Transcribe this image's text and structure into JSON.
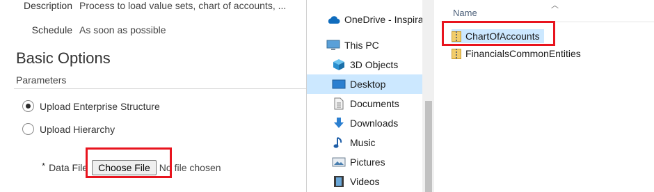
{
  "form": {
    "description_label": "Description",
    "description_value": "Process to load value sets, chart of accounts, ...",
    "schedule_label": "Schedule",
    "schedule_value": "As soon as possible",
    "section_title": "Basic Options",
    "parameters_title": "Parameters",
    "options": [
      {
        "label": "Upload Enterprise Structure",
        "selected": true
      },
      {
        "label": "Upload Hierarchy",
        "selected": false
      }
    ],
    "data_file": {
      "required_mark": "*",
      "label": "Data File",
      "button_label": "Choose File",
      "status": "No file chosen"
    }
  },
  "dialog": {
    "nav": [
      {
        "label": "OneDrive - Inspira",
        "icon": "cloud-icon"
      },
      {
        "label": "This PC",
        "icon": "computer-icon"
      },
      {
        "label": "3D Objects",
        "icon": "cube-icon"
      },
      {
        "label": "Desktop",
        "icon": "desktop-icon",
        "selected": true
      },
      {
        "label": "Documents",
        "icon": "document-icon"
      },
      {
        "label": "Downloads",
        "icon": "download-arrow-icon"
      },
      {
        "label": "Music",
        "icon": "music-note-icon"
      },
      {
        "label": "Pictures",
        "icon": "picture-icon"
      },
      {
        "label": "Videos",
        "icon": "film-icon"
      }
    ],
    "column_header": "Name",
    "files": [
      {
        "name": "ChartOfAccounts",
        "icon": "zip-folder-icon",
        "selected": true
      },
      {
        "name": "FinancialsCommonEntities",
        "icon": "zip-folder-icon",
        "selected": false
      }
    ]
  },
  "colors": {
    "highlight": "#e8141e",
    "selection": "#cce8ff",
    "onedrive_blue": "#0f6cbd"
  }
}
